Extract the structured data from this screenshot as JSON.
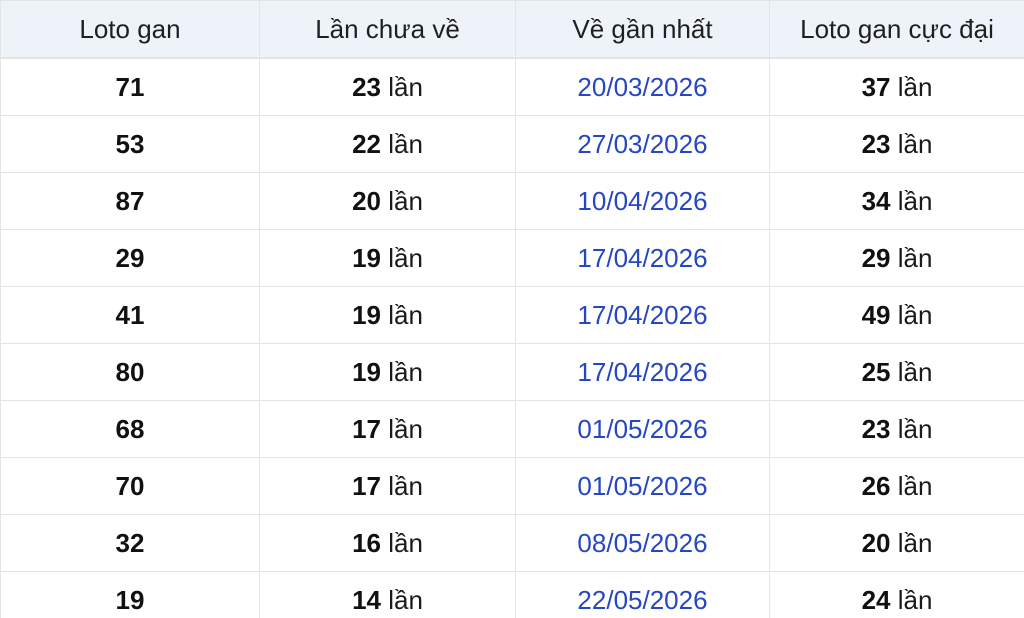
{
  "table": {
    "headers": [
      "Loto gan",
      "Lần chưa về",
      "Về gần nhất",
      "Loto gan cực đại"
    ],
    "unit": "lần",
    "rows": [
      {
        "loto": "71",
        "missing": "23",
        "last_seen": "20/03/2026",
        "max_gap": "37"
      },
      {
        "loto": "53",
        "missing": "22",
        "last_seen": "27/03/2026",
        "max_gap": "23"
      },
      {
        "loto": "87",
        "missing": "20",
        "last_seen": "10/04/2026",
        "max_gap": "34"
      },
      {
        "loto": "29",
        "missing": "19",
        "last_seen": "17/04/2026",
        "max_gap": "29"
      },
      {
        "loto": "41",
        "missing": "19",
        "last_seen": "17/04/2026",
        "max_gap": "49"
      },
      {
        "loto": "80",
        "missing": "19",
        "last_seen": "17/04/2026",
        "max_gap": "25"
      },
      {
        "loto": "68",
        "missing": "17",
        "last_seen": "01/05/2026",
        "max_gap": "23"
      },
      {
        "loto": "70",
        "missing": "17",
        "last_seen": "01/05/2026",
        "max_gap": "26"
      },
      {
        "loto": "32",
        "missing": "16",
        "last_seen": "08/05/2026",
        "max_gap": "20"
      },
      {
        "loto": "19",
        "missing": "14",
        "last_seen": "22/05/2026",
        "max_gap": "24"
      }
    ]
  },
  "colors": {
    "header_bg": "#eef3fa",
    "date_link": "#2647c4",
    "border": "#e4e4e4"
  }
}
